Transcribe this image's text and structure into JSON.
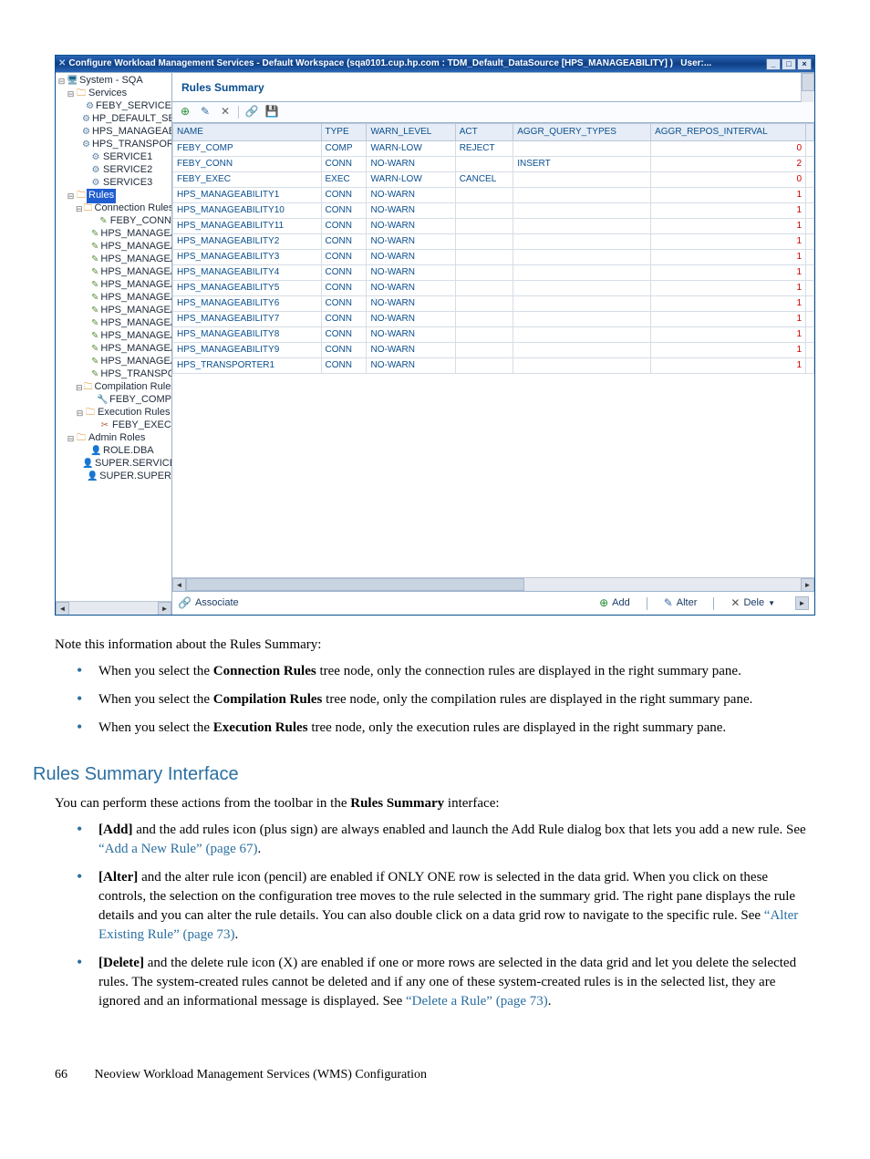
{
  "titlebar": {
    "icon": "✕",
    "text": "Configure Workload Management Services - Default Workspace (sqa0101.cup.hp.com : TDM_Default_DataSource [HPS_MANAGEABILITY] )",
    "user": "User:...",
    "min": "_",
    "max": "□",
    "close": "×"
  },
  "tree": {
    "root": "System - SQA",
    "services_label": "Services",
    "services": [
      "FEBY_SERVICE",
      "HP_DEFAULT_SERV",
      "HPS_MANAGEABIL",
      "HPS_TRANSPORTE",
      "SERVICE1",
      "SERVICE2",
      "SERVICE3"
    ],
    "rules_label": "Rules",
    "conn_rules_label": "Connection Rules",
    "conn_rules": [
      "FEBY_CONN",
      "HPS_MANAGEA",
      "HPS_MANAGEA",
      "HPS_MANAGEA",
      "HPS_MANAGEA",
      "HPS_MANAGEA",
      "HPS_MANAGEA",
      "HPS_MANAGEA",
      "HPS_MANAGEA",
      "HPS_MANAGEA",
      "HPS_MANAGEA",
      "HPS_MANAGEA",
      "HPS_TRANSPO"
    ],
    "comp_rules_label": "Compilation Rules",
    "comp_rules": [
      "FEBY_COMP"
    ],
    "exec_rules_label": "Execution Rules",
    "exec_rules": [
      "FEBY_EXEC"
    ],
    "admin_roles_label": "Admin Roles",
    "admin_roles": [
      "ROLE.DBA",
      "SUPER.SERVICES",
      "SUPER.SUPER"
    ]
  },
  "panel_title": "Rules Summary",
  "columns": [
    "NAME",
    "TYPE",
    "WARN_LEVEL",
    "ACT",
    "AGGR_QUERY_TYPES",
    "AGGR_REPOS_INTERVAL"
  ],
  "rows": [
    {
      "name": "FEBY_COMP",
      "type": "COMP",
      "warn": "WARN-LOW",
      "act": "REJECT",
      "aqt": "",
      "ari": "0"
    },
    {
      "name": "FEBY_CONN",
      "type": "CONN",
      "warn": "NO-WARN",
      "act": "",
      "aqt": "INSERT",
      "ari": "2"
    },
    {
      "name": "FEBY_EXEC",
      "type": "EXEC",
      "warn": "WARN-LOW",
      "act": "CANCEL",
      "aqt": "",
      "ari": "0"
    },
    {
      "name": "HPS_MANAGEABILITY1",
      "type": "CONN",
      "warn": "NO-WARN",
      "act": "",
      "aqt": "",
      "ari": "1"
    },
    {
      "name": "HPS_MANAGEABILITY10",
      "type": "CONN",
      "warn": "NO-WARN",
      "act": "",
      "aqt": "",
      "ari": "1"
    },
    {
      "name": "HPS_MANAGEABILITY11",
      "type": "CONN",
      "warn": "NO-WARN",
      "act": "",
      "aqt": "",
      "ari": "1"
    },
    {
      "name": "HPS_MANAGEABILITY2",
      "type": "CONN",
      "warn": "NO-WARN",
      "act": "",
      "aqt": "",
      "ari": "1"
    },
    {
      "name": "HPS_MANAGEABILITY3",
      "type": "CONN",
      "warn": "NO-WARN",
      "act": "",
      "aqt": "",
      "ari": "1"
    },
    {
      "name": "HPS_MANAGEABILITY4",
      "type": "CONN",
      "warn": "NO-WARN",
      "act": "",
      "aqt": "",
      "ari": "1"
    },
    {
      "name": "HPS_MANAGEABILITY5",
      "type": "CONN",
      "warn": "NO-WARN",
      "act": "",
      "aqt": "",
      "ari": "1"
    },
    {
      "name": "HPS_MANAGEABILITY6",
      "type": "CONN",
      "warn": "NO-WARN",
      "act": "",
      "aqt": "",
      "ari": "1"
    },
    {
      "name": "HPS_MANAGEABILITY7",
      "type": "CONN",
      "warn": "NO-WARN",
      "act": "",
      "aqt": "",
      "ari": "1"
    },
    {
      "name": "HPS_MANAGEABILITY8",
      "type": "CONN",
      "warn": "NO-WARN",
      "act": "",
      "aqt": "",
      "ari": "1"
    },
    {
      "name": "HPS_MANAGEABILITY9",
      "type": "CONN",
      "warn": "NO-WARN",
      "act": "",
      "aqt": "",
      "ari": "1"
    },
    {
      "name": "HPS_TRANSPORTER1",
      "type": "CONN",
      "warn": "NO-WARN",
      "act": "",
      "aqt": "",
      "ari": "1"
    }
  ],
  "actions": {
    "associate": "Associate",
    "add": "Add",
    "alter": "Alter",
    "dele": "Dele"
  },
  "doc": {
    "note_intro": "Note this information about the Rules Summary:",
    "note1_a": "When you select the ",
    "note1_b": "Connection Rules",
    "note1_c": " tree node, only the connection rules are displayed in the right summary pane.",
    "note2_a": "When you select the ",
    "note2_b": "Compilation Rules",
    "note2_c": " tree node, only the compilation rules are displayed in the right summary pane.",
    "note3_a": "When you select the ",
    "note3_b": "Execution Rules",
    "note3_c": " tree node, only the execution rules are displayed in the right summary pane.",
    "h2": "Rules Summary Interface",
    "intro2_a": "You can perform these actions from the toolbar in the ",
    "intro2_b": "Rules Summary",
    "intro2_c": " interface:",
    "add_a": "[Add]",
    "add_b": " and the add rules icon (plus sign) are always enabled and launch the Add Rule dialog box that lets you add a new rule. See ",
    "add_link": "“Add a New Rule” (page 67)",
    "add_c": ".",
    "alter_a": "[Alter]",
    "alter_b": " and the alter rule icon (pencil) are enabled if ONLY ONE row is selected in the data grid. When you click on these controls, the selection on the configuration tree moves to the rule selected in the summary grid. The right pane displays the rule details and you can alter the rule details. You can also double click on a data grid row to navigate to the specific rule. See ",
    "alter_link": "“Alter Existing Rule” (page 73)",
    "alter_c": ".",
    "del_a": "[Delete]",
    "del_b": " and the delete rule icon (X) are enabled if one or more rows are selected in the data grid and let you delete the selected rules. The system-created rules cannot be deleted and if any one of these system-created rules is in the selected list, they are ignored and an informational message is displayed. See ",
    "del_link": "“Delete a Rule” (page 73)",
    "del_c": "."
  },
  "footer": {
    "page": "66",
    "title": "Neoview Workload Management Services (WMS) Configuration"
  }
}
